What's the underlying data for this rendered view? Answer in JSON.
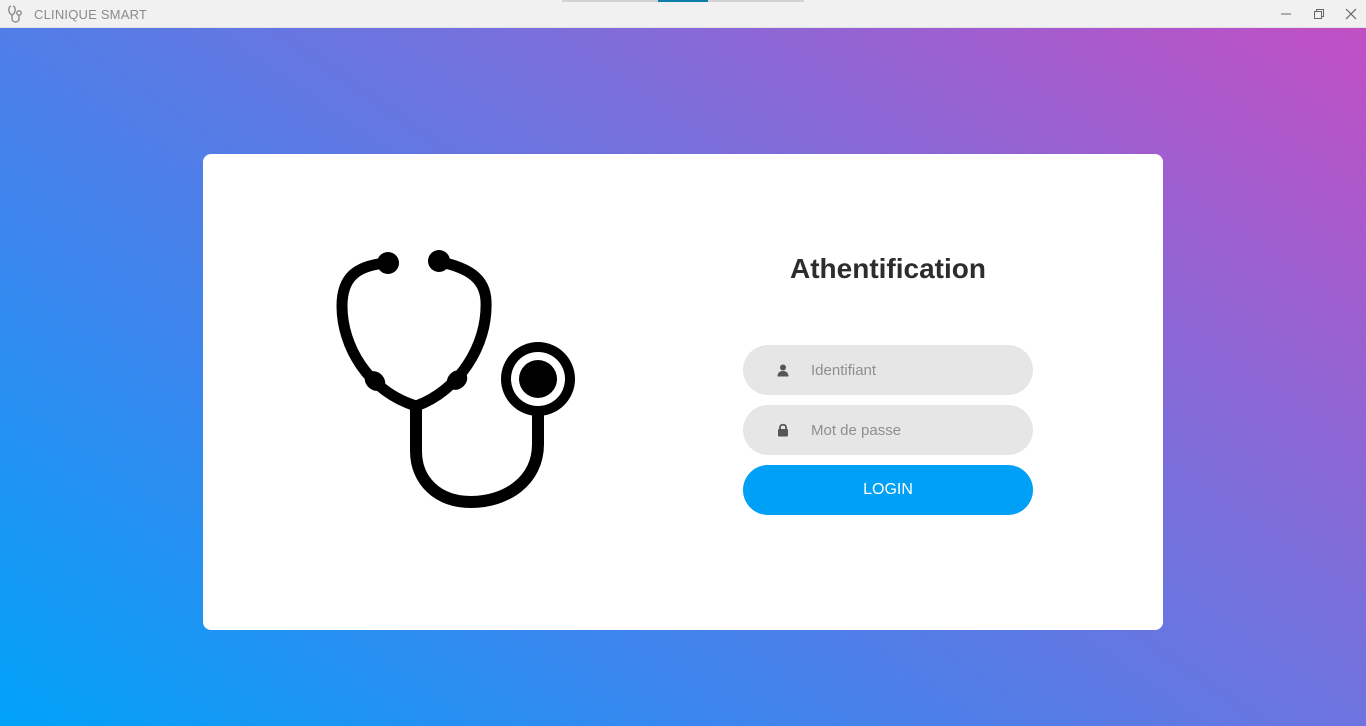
{
  "window": {
    "title": "CLINIQUE SMART",
    "icon": "stethoscope-icon",
    "controls": [
      "minimize-icon",
      "restore-icon",
      "close-icon"
    ]
  },
  "colors": {
    "gradient_start": "#00a2f8",
    "gradient_end": "#c14fc4",
    "login_button": "#00a0f6",
    "field_background": "#e6e6e6"
  },
  "login": {
    "illustration": "stethoscope-icon",
    "heading": "Athentification",
    "username": {
      "placeholder": "Identifiant",
      "value": "",
      "icon": "user-icon"
    },
    "password": {
      "placeholder": "Mot de passe",
      "value": "",
      "icon": "lock-icon"
    },
    "submit_label": "LOGIN"
  }
}
